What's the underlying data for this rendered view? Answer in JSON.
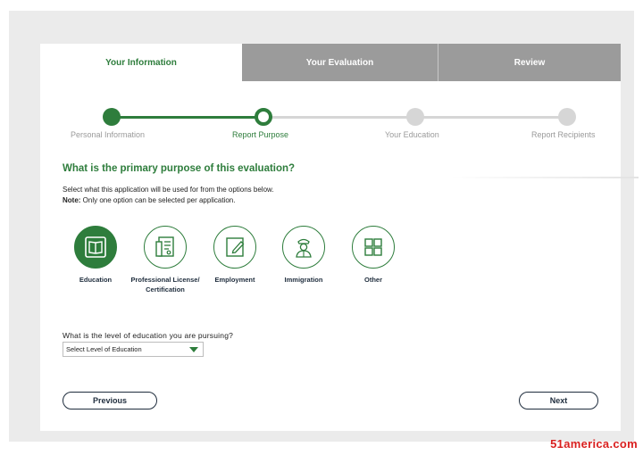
{
  "tabs": [
    {
      "label": "Your Information",
      "state": "active"
    },
    {
      "label": "Your Evaluation",
      "state": "inactive"
    },
    {
      "label": "Review",
      "state": "inactive"
    }
  ],
  "stepper": {
    "steps": [
      {
        "label": "Personal Information",
        "status": "complete"
      },
      {
        "label": "Report Purpose",
        "status": "current"
      },
      {
        "label": "Your Education",
        "status": "upcoming"
      },
      {
        "label": "Report Recipients",
        "status": "upcoming"
      }
    ]
  },
  "question": {
    "title": "What is the primary purpose of this evaluation?",
    "instruction": "Select what this application will be used for from the options below.",
    "note_label": "Note:",
    "note_text": " Only one option can be selected per application."
  },
  "purposes": [
    {
      "label": "Education",
      "icon": "book-icon",
      "selected": true
    },
    {
      "label": "Professional License/ Certification",
      "icon": "certificate-icon",
      "selected": false
    },
    {
      "label": "Employment",
      "icon": "pen-document-icon",
      "selected": false
    },
    {
      "label": "Immigration",
      "icon": "officer-icon",
      "selected": false
    },
    {
      "label": "Other",
      "icon": "grid-icon",
      "selected": false
    }
  ],
  "education": {
    "question": "What is the level of education you are pursuing?",
    "select_value": "Select Level of Education"
  },
  "buttons": {
    "previous": "Previous",
    "next": "Next"
  },
  "watermark": "51america.com",
  "colors": {
    "accent": "#2e7d3c",
    "tab_inactive": "#9b9b9b",
    "step_upcoming": "#d6d6d6",
    "button_text": "#1f2d3d"
  }
}
